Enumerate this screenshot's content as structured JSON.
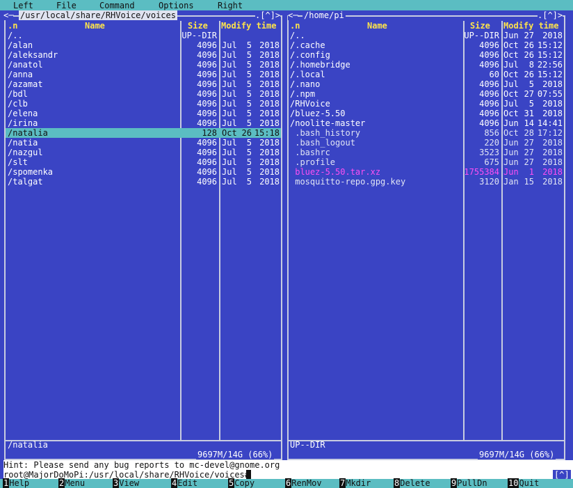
{
  "menu": [
    "Left",
    "File",
    "Command",
    "Options",
    "Right"
  ],
  "left_panel": {
    "path": "/usr/local/share/RHVoice/voices",
    "corner": ".[^]>",
    "headers": {
      "sort": ".n",
      "name": "Name",
      "size": "Size",
      "mtime": "Modify time"
    },
    "rows": [
      {
        "name": "/..",
        "size": "UP--DIR",
        "month": "",
        "day": "",
        "time": ""
      },
      {
        "name": "/alan",
        "size": "4096",
        "month": "Jul",
        "day": "5",
        "time": "2018"
      },
      {
        "name": "/aleksandr",
        "size": "4096",
        "month": "Jul",
        "day": "5",
        "time": "2018"
      },
      {
        "name": "/anatol",
        "size": "4096",
        "month": "Jul",
        "day": "5",
        "time": "2018"
      },
      {
        "name": "/anna",
        "size": "4096",
        "month": "Jul",
        "day": "5",
        "time": "2018"
      },
      {
        "name": "/azamat",
        "size": "4096",
        "month": "Jul",
        "day": "5",
        "time": "2018"
      },
      {
        "name": "/bdl",
        "size": "4096",
        "month": "Jul",
        "day": "5",
        "time": "2018"
      },
      {
        "name": "/clb",
        "size": "4096",
        "month": "Jul",
        "day": "5",
        "time": "2018"
      },
      {
        "name": "/elena",
        "size": "4096",
        "month": "Jul",
        "day": "5",
        "time": "2018"
      },
      {
        "name": "/irina",
        "size": "4096",
        "month": "Jul",
        "day": "5",
        "time": "2018"
      },
      {
        "name": "/natalia",
        "size": "128",
        "month": "Oct",
        "day": "26",
        "time": "15:18",
        "selected": true
      },
      {
        "name": "/natia",
        "size": "4096",
        "month": "Jul",
        "day": "5",
        "time": "2018"
      },
      {
        "name": "/nazgul",
        "size": "4096",
        "month": "Jul",
        "day": "5",
        "time": "2018"
      },
      {
        "name": "/slt",
        "size": "4096",
        "month": "Jul",
        "day": "5",
        "time": "2018"
      },
      {
        "name": "/spomenka",
        "size": "4096",
        "month": "Jul",
        "day": "5",
        "time": "2018"
      },
      {
        "name": "/talgat",
        "size": "4096",
        "month": "Jul",
        "day": "5",
        "time": "2018"
      }
    ],
    "mini_status": "/natalia",
    "disk": "9697M/14G (66%)"
  },
  "right_panel": {
    "path": "/home/pi",
    "corner": ".[^]>",
    "headers": {
      "sort": ".n",
      "name": "Name",
      "size": "Size",
      "mtime": "Modify time"
    },
    "rows": [
      {
        "name": "/..",
        "size": "UP--DIR",
        "month": "Jun",
        "day": "27",
        "time": "2018"
      },
      {
        "name": "/.cache",
        "size": "4096",
        "month": "Oct",
        "day": "26",
        "time": "15:12"
      },
      {
        "name": "/.config",
        "size": "4096",
        "month": "Oct",
        "day": "26",
        "time": "15:12"
      },
      {
        "name": "/.homebridge",
        "size": "4096",
        "month": "Jul",
        "day": "8",
        "time": "22:56"
      },
      {
        "name": "/.local",
        "size": "60",
        "month": "Oct",
        "day": "26",
        "time": "15:12"
      },
      {
        "name": "/.nano",
        "size": "4096",
        "month": "Jul",
        "day": "5",
        "time": "2018"
      },
      {
        "name": "/.npm",
        "size": "4096",
        "month": "Oct",
        "day": "27",
        "time": "07:55"
      },
      {
        "name": "/RHVoice",
        "size": "4096",
        "month": "Jul",
        "day": "5",
        "time": "2018"
      },
      {
        "name": "/bluez-5.50",
        "size": "4096",
        "month": "Oct",
        "day": "31",
        "time": "2018"
      },
      {
        "name": "/noolite-master",
        "size": "4096",
        "month": "Jun",
        "day": "14",
        "time": "14:41"
      },
      {
        "name": " .bash_history",
        "size": "856",
        "month": "Oct",
        "day": "28",
        "time": "17:12",
        "dim": true
      },
      {
        "name": " .bash_logout",
        "size": "220",
        "month": "Jun",
        "day": "27",
        "time": "2018",
        "dim": true
      },
      {
        "name": " .bashrc",
        "size": "3523",
        "month": "Jun",
        "day": "27",
        "time": "2018",
        "dim": true
      },
      {
        "name": " .profile",
        "size": "675",
        "month": "Jun",
        "day": "27",
        "time": "2018",
        "dim": true
      },
      {
        "name": " bluez-5.50.tar.xz",
        "size": "1755384",
        "month": "Jun",
        "day": "1",
        "time": "2018",
        "pink": true
      },
      {
        "name": " mosquitto-repo.gpg.key",
        "size": "3120",
        "month": "Jan",
        "day": "15",
        "time": "2018",
        "dim": true
      }
    ],
    "mini_status": "UP--DIR",
    "disk": "9697M/14G (66%)"
  },
  "hint": "Hint: Please send any bug reports to mc-devel@gnome.org",
  "prompt": "root@MajorDoMoPi:/usr/local/share/RHVoice/voices#",
  "scroll_indicator": "[^]",
  "fkeys": [
    {
      "num": "1",
      "label": "Help"
    },
    {
      "num": "2",
      "label": "Menu"
    },
    {
      "num": "3",
      "label": "View"
    },
    {
      "num": "4",
      "label": "Edit"
    },
    {
      "num": "5",
      "label": "Copy"
    },
    {
      "num": "6",
      "label": "RenMov"
    },
    {
      "num": "7",
      "label": "Mkdir"
    },
    {
      "num": "8",
      "label": "Delete"
    },
    {
      "num": "9",
      "label": "PullDn"
    },
    {
      "num": "10",
      "label": "Quit"
    }
  ]
}
